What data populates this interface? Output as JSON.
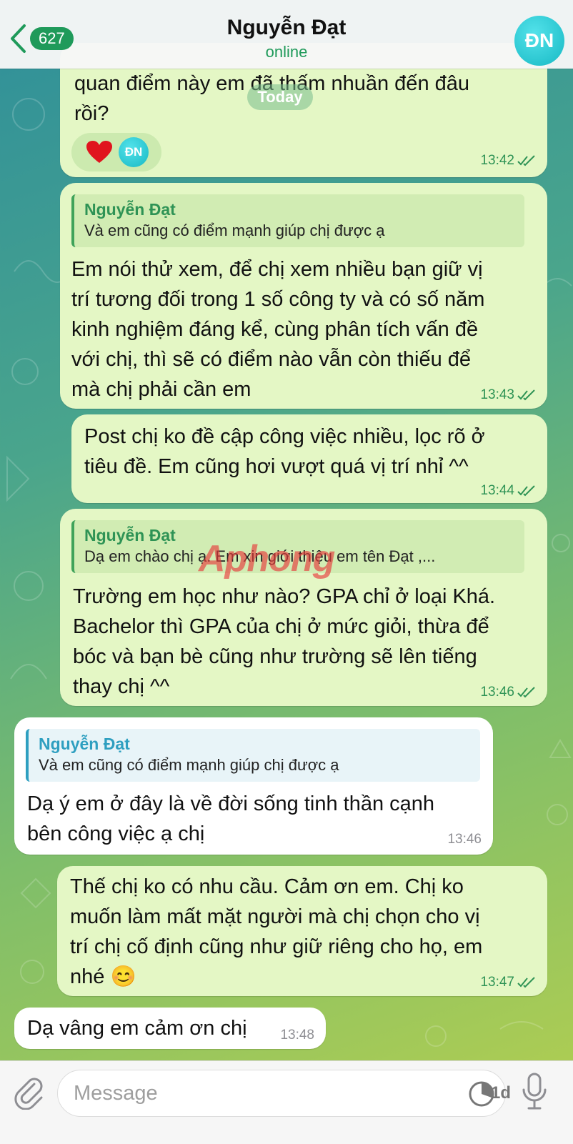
{
  "header": {
    "back_count": "627",
    "contact_name": "Nguyễn Đạt",
    "status": "online",
    "avatar_initials": "ĐN"
  },
  "date_chip": "Today",
  "messages": [
    {
      "id": "m1",
      "side": "out",
      "text_lines": [
        "quan điểm này em đã thấm nhuần đến đâu",
        "rồi?"
      ],
      "reaction": {
        "emoji": "heart",
        "avatar_initials": "ĐN"
      },
      "time": "13:42",
      "read": true
    },
    {
      "id": "m2",
      "side": "out",
      "reply_to": {
        "name": "Nguyễn Đạt",
        "text": "Và em cũng có điểm mạnh giúp chị được ạ"
      },
      "text_lines": [
        "Em nói thử xem, để chị xem nhiều bạn giữ vị",
        "trí tương đối trong 1 số công ty và có số năm",
        "kinh nghiệm đáng kể, cùng phân tích vấn đề",
        "với chị, thì sẽ có điểm nào vẫn còn thiếu để",
        "mà chị phải cần em"
      ],
      "time": "13:43",
      "read": true
    },
    {
      "id": "m3",
      "side": "out",
      "text_lines": [
        "Post chị ko đề cập công việc nhiều, lọc rõ ở",
        "tiêu đề. Em cũng hơi vượt quá vị trí nhỉ ^^"
      ],
      "time": "13:44",
      "read": true
    },
    {
      "id": "m4",
      "side": "out",
      "reply_to": {
        "name": "Nguyễn Đạt",
        "text": "Dạ em chào chị ạ. Em xin giới thiệu em tên Đạt ,..."
      },
      "text_lines": [
        "Trường em học như nào? GPA chỉ ở loại Khá.",
        "Bachelor thì GPA của chị ở mức giỏi, thừa để",
        "bóc và bạn bè cũng như trường sẽ lên tiếng",
        "thay chị ^^"
      ],
      "time": "13:46",
      "read": true
    },
    {
      "id": "m5",
      "side": "in",
      "reply_to": {
        "name": "Nguyễn Đạt",
        "text": "Và em cũng có điểm mạnh giúp chị được ạ"
      },
      "text_lines": [
        "Dạ ý em ở đây là về đời sống tinh thần cạnh",
        "bên công việc ạ chị"
      ],
      "time": "13:46"
    },
    {
      "id": "m6",
      "side": "out",
      "text_lines": [
        "Thế chị ko có nhu cầu. Cảm ơn em. Chị ko",
        "muốn làm mất mặt người mà chị chọn cho vị",
        "trí chị cố định cũng như giữ riêng cho họ, em",
        "nhé 😊"
      ],
      "time": "13:47",
      "read": true
    },
    {
      "id": "m7",
      "side": "in",
      "text_lines": [
        "Dạ vâng em cảm ơn chị"
      ],
      "time": "13:48"
    }
  ],
  "watermark": "Aphong",
  "composer": {
    "placeholder": "Message",
    "timer_label": "1d"
  },
  "colors": {
    "outgoing_bubble": "#e4f7c5",
    "incoming_bubble": "#ffffff",
    "accent_green": "#1f9a5a",
    "reply_blue": "#2e9fc0"
  }
}
